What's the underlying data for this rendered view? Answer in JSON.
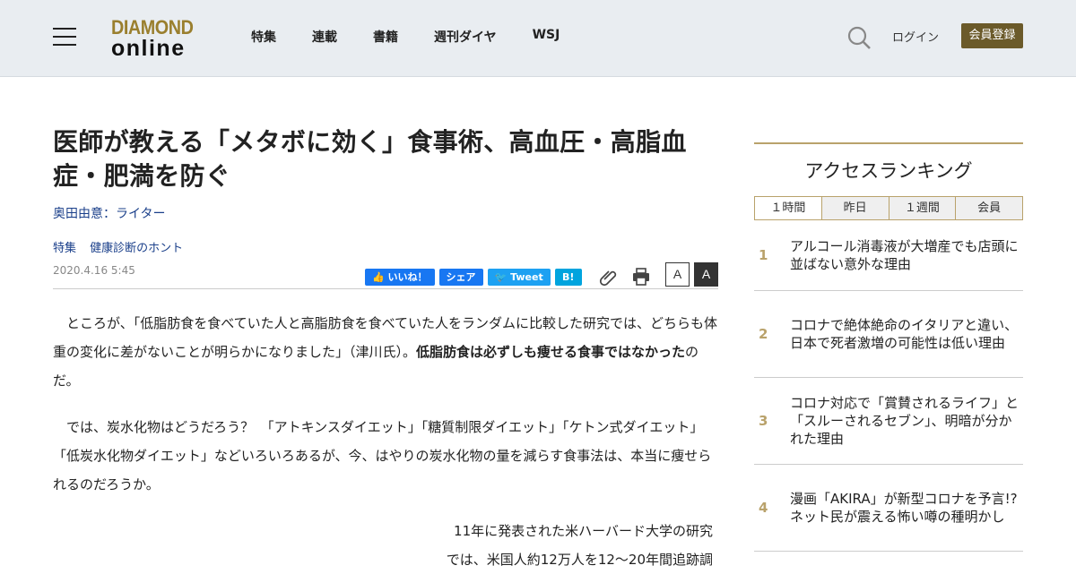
{
  "header": {
    "logo_top": "DIAMOND",
    "logo_bottom": "online",
    "nav": [
      "特集",
      "連載",
      "書籍",
      "週刊ダイヤ",
      "WSJ"
    ],
    "login": "ログイン",
    "register": "会員登録"
  },
  "article": {
    "title": "医師が教える「メタボに効く」食事術、高血圧・高脂血症・肥満を防ぐ",
    "author": "奥田由意：ライター",
    "tags": [
      "特集",
      "健康診断のホント"
    ],
    "date": "2020.4.16 5:45",
    "share": {
      "like": "いいね！",
      "fb_share": "シェア",
      "tweet": "Tweet",
      "hatena": "B!"
    },
    "font_small": "A",
    "font_large": "A",
    "p1_a": "ところが、「低脂肪食を食べていた人と高脂肪食を食べていた人をランダムに比較した研究では、どちらも体重の変化に差がないことが明らかになりました」（津川氏）。",
    "p1_b": "低脂肪食は必ずしも痩せる食事ではなかった",
    "p1_c": "のだ。",
    "p2": "では、炭水化物はどうだろう？　「アトキンスダイエット」「糖質制限ダイエット」「ケトン式ダイエット」「低炭水化物ダイエット」などいろいろあるが、今、はやりの炭水化物の量を減らす食事法は、本当に痩せられるのだろうか。",
    "p3_line1": "11年に発表された米ハーバード大学の研究",
    "p3_line2": "では、米国人約12万人を12〜20年間追跡調"
  },
  "sidebar": {
    "heading": "アクセスランキング",
    "tabs": [
      "１時間",
      "昨日",
      "１週間",
      "会員"
    ],
    "items": [
      {
        "rank": "1",
        "text": "アルコール消毒液が大増産でも店頭に並ばない意外な理由"
      },
      {
        "rank": "2",
        "text": "コロナで絶体絶命のイタリアと違い、日本で死者激増の可能性は低い理由"
      },
      {
        "rank": "3",
        "text": "コロナ対応で「賞賛されるライフ」と「スルーされるセブン」、明暗が分かれた理由"
      },
      {
        "rank": "4",
        "text": "漫画「AKIRA」が新型コロナを予言!?ネット民が震える怖い噂の種明かし"
      }
    ]
  },
  "colors": {
    "accent_gold": "#b9a26b",
    "register_bg": "#6b5a2a",
    "link_blue": "#1a3f8a"
  }
}
